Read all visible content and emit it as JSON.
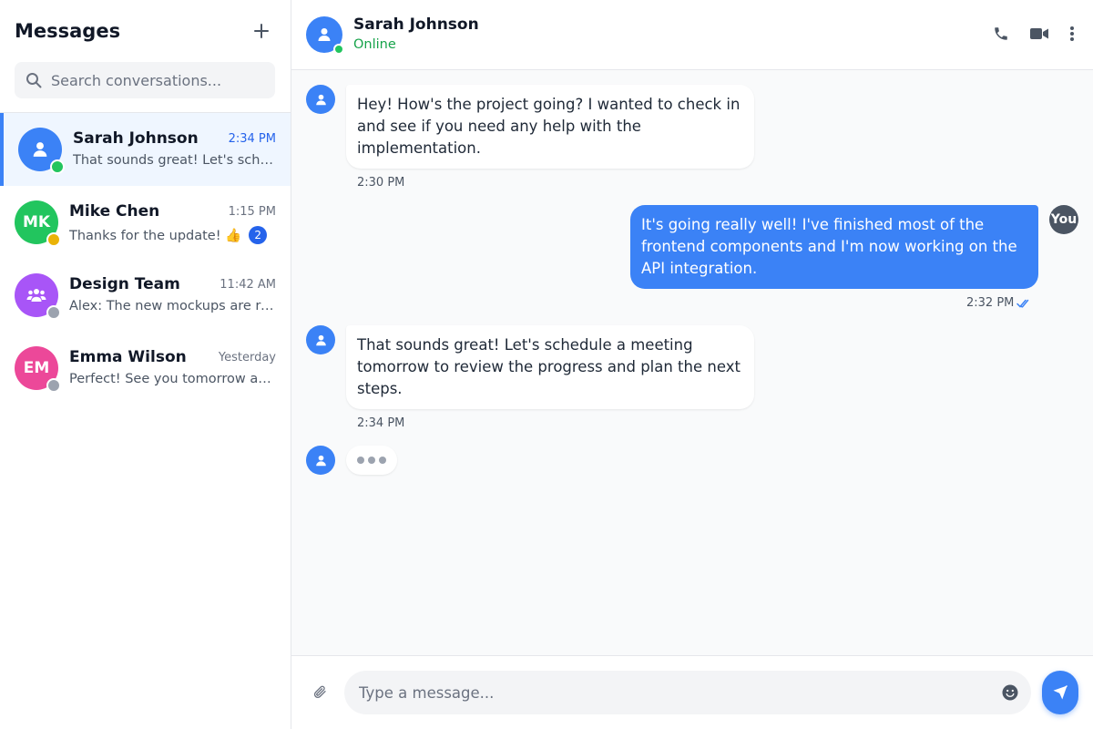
{
  "sidebar": {
    "title": "Messages",
    "new_icon": "plus-icon",
    "search": {
      "placeholder": "Search conversations...",
      "value": ""
    },
    "conversations": [
      {
        "name": "Sarah Johnson",
        "time": "2:34 PM",
        "preview": "That sounds great! Let's schedule a meeting tomorrow",
        "avatar_icon": "user-icon",
        "initials": "",
        "avatar_color": "#3b82f6",
        "status_color": "#22c55e",
        "unread": "",
        "active": true
      },
      {
        "name": "Mike Chen",
        "time": "1:15 PM",
        "preview": "Thanks for the update! 👍",
        "avatar_icon": "",
        "initials": "MK",
        "avatar_color": "#22c55e",
        "status_color": "#eab308",
        "unread": "2",
        "active": false
      },
      {
        "name": "Design Team",
        "time": "11:42 AM",
        "preview": "Alex: The new mockups are ready for review",
        "avatar_icon": "users-icon",
        "initials": "",
        "avatar_color": "#a855f7",
        "status_color": "#9ca3af",
        "unread": "",
        "active": false
      },
      {
        "name": "Emma Wilson",
        "time": "Yesterday",
        "preview": "Perfect! See you tomorrow at the meeting",
        "avatar_icon": "",
        "initials": "EM",
        "avatar_color": "#ec4899",
        "status_color": "#9ca3af",
        "unread": "",
        "active": false
      }
    ]
  },
  "chat": {
    "contact_name": "Sarah Johnson",
    "contact_status": "Online",
    "avatar_color": "#3b82f6",
    "status_color": "#22c55e",
    "actions": [
      "phone-icon",
      "video-icon",
      "more-vertical-icon"
    ],
    "messages": [
      {
        "direction": "in",
        "text": "Hey! How's the project going? I wanted to check in and see if you need any help with the implementation.",
        "time": "2:30 PM"
      },
      {
        "direction": "out",
        "text": "It's going really well! I've finished most of the frontend components and I'm now working on the API integration.",
        "time": "2:32 PM",
        "sender_label": "You",
        "read_icon": "double-check-icon"
      },
      {
        "direction": "in",
        "text": "That sounds great! Let's schedule a meeting tomorrow to review the progress and plan the next steps.",
        "time": "2:34 PM"
      }
    ],
    "typing_indicator": true
  },
  "composer": {
    "placeholder": "Type a message...",
    "value": "",
    "attach_icon": "paperclip-icon",
    "emoji_icon": "smile-icon",
    "send_icon": "send-icon"
  },
  "colors": {
    "accent": "#3b82f6",
    "online": "#22c55e",
    "away": "#eab308",
    "offline": "#9ca3af",
    "out_avatar": "#4b5563"
  }
}
